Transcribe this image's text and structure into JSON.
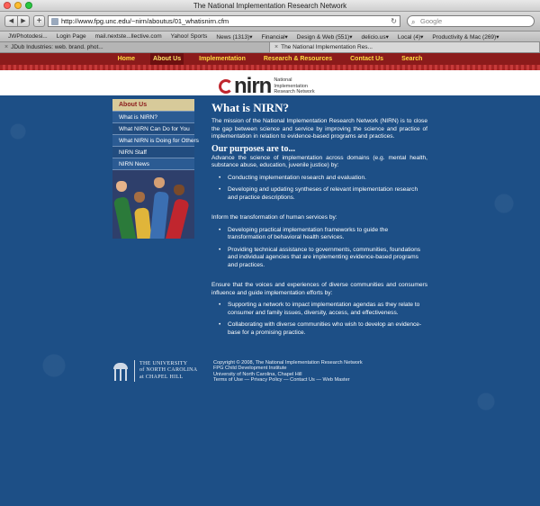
{
  "window": {
    "title": "The National Implementation Research Network"
  },
  "toolbar": {
    "url": "http://www.fpg.unc.edu/~nirn/aboutus/01_whatisnirn.cfm",
    "search_placeholder": "Google",
    "back_glyph": "◀",
    "forward_glyph": "▶",
    "add_glyph": "+",
    "reload_glyph": "↻"
  },
  "bookmarks": [
    "JWPhotodesi...",
    "Login Page",
    "mail.nextste...llective.com",
    "Yahoo! Sports",
    "News (1313)▾",
    "Financial▾",
    "Design & Web (551)▾",
    "delicio.us▾",
    "Local (4)▾",
    "Productivity & Mac (269)▾"
  ],
  "tabs": [
    {
      "label": "JDub Industries: web. brand. phot...",
      "active": false
    },
    {
      "label": "The National Implementation Res...",
      "active": true
    }
  ],
  "site_nav": [
    {
      "label": "Home",
      "active": false
    },
    {
      "label": "About Us",
      "active": true
    },
    {
      "label": "Implementation",
      "active": false
    },
    {
      "label": "Research & Resources",
      "active": false
    },
    {
      "label": "Contact Us",
      "active": false
    },
    {
      "label": "Search",
      "active": false
    }
  ],
  "logo": {
    "word": "nirn",
    "line1": "National",
    "line2": "Implementation",
    "line3": "Research Network"
  },
  "sidebar": {
    "header": "About Us",
    "items": [
      "What is NIRN?",
      "What NIRN Can Do for You",
      "What NIRN is Doing for Others",
      "NIRN Staff",
      "NIRN News"
    ]
  },
  "main": {
    "title": "What is NIRN?",
    "intro": "The mission of the National Implementation Research Network (NIRN) is to close the gap between science and service by improving the science and practice of implementation in relation to evidence-based programs and practices.",
    "subtitle": "Our purposes are to...",
    "sections": [
      {
        "lead": "Advance the science of implementation across domains (e.g. mental health, substance abuse, education, juvenile justice) by:",
        "bullets": [
          "Conducting implementation research and evaluation.",
          "Developing and updating syntheses of relevant implementation research and practice descriptions."
        ]
      },
      {
        "lead": "Inform the transformation of human services by:",
        "bullets": [
          "Developing practical implementation frameworks to guide the transformation of behavioral health services.",
          "Providing technical assistance to governments, communities, foundations and individual agencies that are implementing evidence-based programs and practices."
        ]
      },
      {
        "lead": "Ensure that the voices and experiences of diverse communities and consumers influence and guide implementation efforts by:",
        "bullets": [
          "Supporting a network to impact implementation agendas as they relate to consumer and family issues, diversity, access, and effectiveness.",
          "Collaborating with diverse communities who wish to develop an evidence-base for a promising practice."
        ]
      }
    ]
  },
  "footer": {
    "unc_line1": "THE UNIVERSITY",
    "unc_line2": "of NORTH CAROLINA",
    "unc_line3": "at CHAPEL HILL",
    "copyright": "Copyright © 2008, The National Implementation Research Network",
    "institute": "FPG Child Development Institute",
    "university": "University of North Carolina, Chapel Hill",
    "links": "Terms of Use — Privacy Policy — Contact Us — Web Master"
  },
  "colors": {
    "nav_bg": "#8b1b1b",
    "nav_text": "#ffdf40",
    "page_bg": "#1d4f86",
    "sidebar_header": "#d7ca9a"
  }
}
